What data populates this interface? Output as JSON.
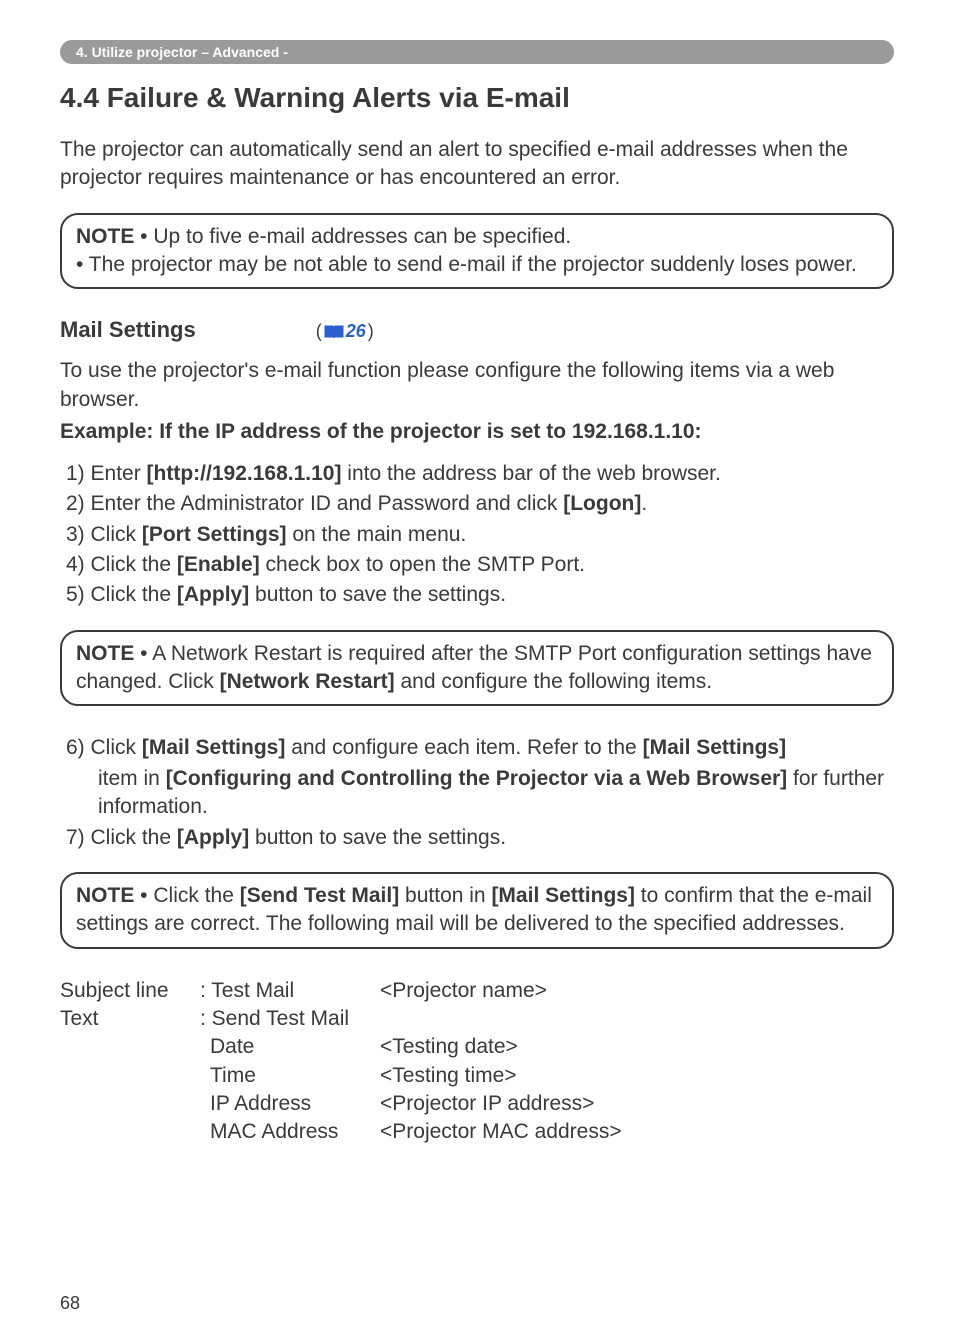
{
  "breadcrumb": "4. Utilize projector – Advanced -",
  "heading": "4.4 Failure & Warning Alerts via E-mail",
  "intro": "The projector can automatically send an alert to specified e-mail addresses when the projector requires maintenance or has encountered an error.",
  "note1": {
    "label": "NOTE",
    "line1": " • Up to five e-mail addresses can be specified.",
    "line2": "• The projector may be not able to send e-mail if the projector suddenly loses power."
  },
  "subsection_title": "Mail Settings",
  "page_ref_num": "26",
  "subsection_intro": "To use the projector's e-mail function please configure the following items via a web browser.",
  "example_line": "Example: If the IP address of the projector is set to 192.168.1.10:",
  "steps": {
    "s1a": " 1) Enter ",
    "s1b": "[http://192.168.1.10]",
    "s1c": " into the address bar of the web browser.",
    "s2a": " 2) Enter the Administrator ID and Password and click ",
    "s2b": "[Logon]",
    "s2c": ".",
    "s3a": " 3) Click ",
    "s3b": "[Port Settings]",
    "s3c": " on the main menu.",
    "s4a": " 4) Click the ",
    "s4b": "[Enable]",
    "s4c": " check box to open the SMTP Port.",
    "s5a": " 5) Click the ",
    "s5b": "[Apply]",
    "s5c": " button to save the settings."
  },
  "note2": {
    "label": "NOTE",
    "text_a": " • A Network Restart is required after the SMTP Port configuration settings have changed. Click ",
    "text_b": "[Network Restart]",
    "text_c": " and configure the following items."
  },
  "steps2": {
    "s6a": " 6) Click ",
    "s6b": "[Mail Settings]",
    "s6c": " and configure each item. Refer to the ",
    "s6d": "[Mail Settings]",
    "s6e": "item in ",
    "s6f": "[Configuring and Controlling the Projector via a Web Browser]",
    "s6g": " for further information.",
    "s6h": "further information.",
    "s7a": " 7) Click the ",
    "s7b": "[Apply]",
    "s7c": " button to save the settings."
  },
  "note3": {
    "label": "NOTE",
    "text_a": " • Click the ",
    "text_b": "[Send Test Mail]",
    "text_c": " button in ",
    "text_d": "[Mail Settings]",
    "text_e": " to confirm that the e-mail settings are correct. The following mail will be delivered to the specified addresses."
  },
  "mail": {
    "r1c1": "Subject line",
    "r1c2": ": Test Mail",
    "r1c3": "<Projector name>",
    "r2c1": "Text",
    "r2c2": ": Send Test Mail",
    "r2c3": "",
    "r3c2": "Date",
    "r3c3": "<Testing date>",
    "r4c2": "Time",
    "r4c3": "<Testing time>",
    "r5c2": "IP Address",
    "r5c3": "<Projector IP address>",
    "r6c2": "MAC Address",
    "r6c3": "<Projector MAC address>"
  },
  "page_number": "68"
}
